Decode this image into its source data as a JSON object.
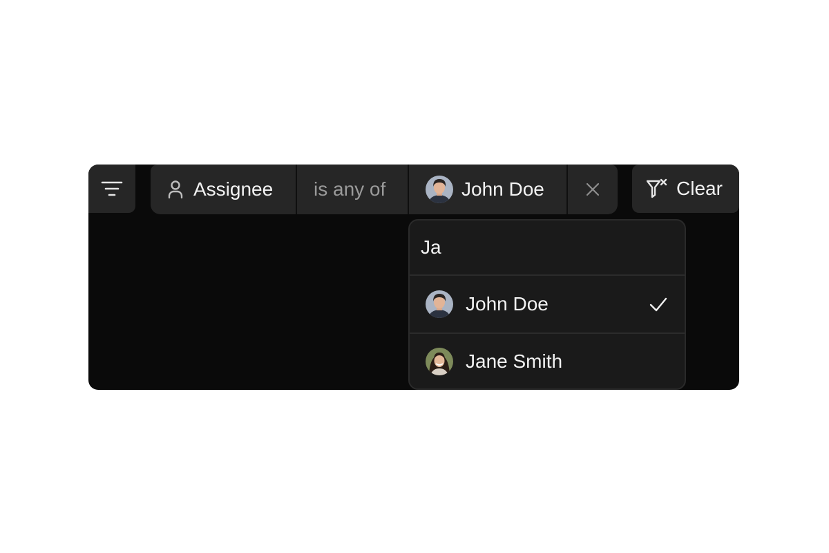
{
  "filter_bar": {
    "filter_menu_icon": "filter-lines-icon",
    "field": {
      "icon": "person-icon",
      "label": "Assignee"
    },
    "operator": {
      "label": "is any of"
    },
    "value": {
      "avatar": "john-doe-avatar",
      "label": "John Doe"
    },
    "remove_icon": "close-icon",
    "clear": {
      "icon": "filter-clear-icon",
      "label": "Clear"
    }
  },
  "dropdown": {
    "search": {
      "value": "Ja"
    },
    "options": [
      {
        "label": "John Doe",
        "selected": true,
        "avatar": "john-doe-avatar"
      },
      {
        "label": "Jane Smith",
        "selected": false,
        "avatar": "jane-smith-avatar"
      }
    ]
  },
  "colors": {
    "panel_bg": "#0a0a0a",
    "chip_bg": "#262626",
    "dropdown_bg": "#1a1a1a",
    "text": "#f2f2f2",
    "muted_text": "#9a9a9a"
  }
}
